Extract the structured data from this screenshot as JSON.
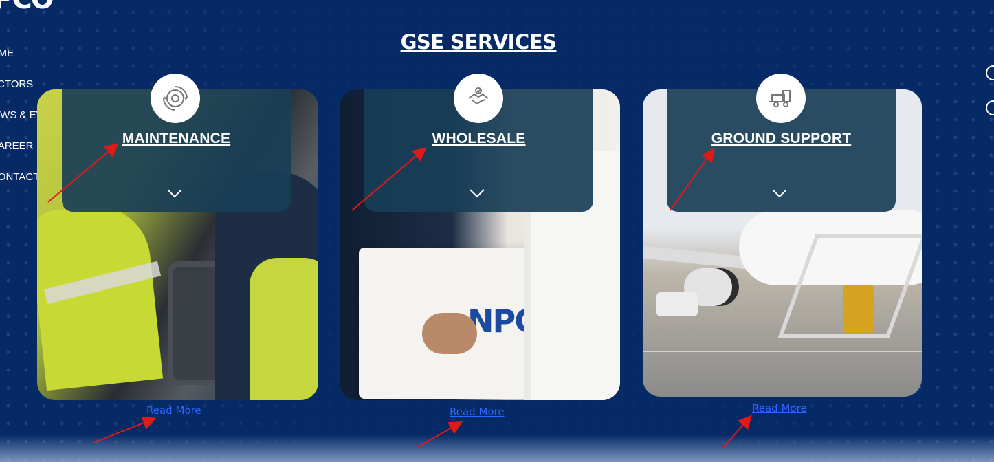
{
  "page": {
    "title": "GSE SERVICES"
  },
  "brand": {
    "logo_text": "PCO"
  },
  "nav": {
    "items": [
      {
        "label": "OME"
      },
      {
        "label": "ECTORS"
      },
      {
        "label": "IEWS & EVENTS"
      },
      {
        "label": "CAREER"
      },
      {
        "label": "CONTACT US"
      }
    ]
  },
  "cards": [
    {
      "title": "MAINTENANCE",
      "icon": "gear-cycle-icon",
      "read_more": "Read More"
    },
    {
      "title": "WHOLESALE",
      "icon": "handshake-icon",
      "read_more": "Read More"
    },
    {
      "title": "GROUND SUPPORT",
      "icon": "tug-vehicle-icon",
      "read_more": "Read More"
    }
  ],
  "image_text": {
    "box_logo": "NPC"
  },
  "colors": {
    "background": "#062a66",
    "overlay": "#193e57",
    "link": "#2a66ff",
    "annotation_arrow": "#e01919"
  }
}
